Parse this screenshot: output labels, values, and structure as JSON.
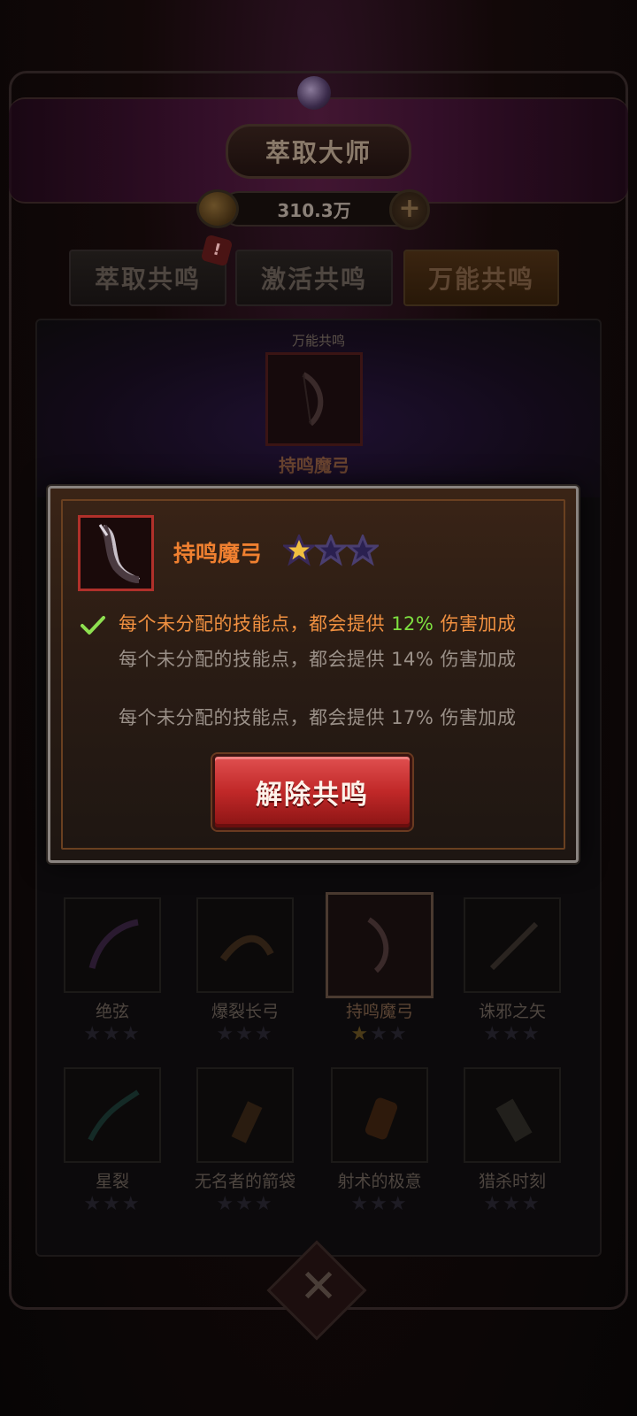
{
  "header": {
    "title": "萃取大师",
    "currency_value": "310.3万"
  },
  "tabs": [
    {
      "label": "萃取共鸣"
    },
    {
      "label": "激活共鸣"
    },
    {
      "label": "万能共鸣"
    }
  ],
  "badge": "!",
  "top_slot": {
    "label": "万能共鸣",
    "name": "持鸣魔弓"
  },
  "modal": {
    "item_name": "持鸣魔弓",
    "stars_filled": 1,
    "stars_total": 3,
    "effects": [
      {
        "text_before": "每个未分配的技能点，都会提供 ",
        "pct": "12%",
        "text_after": " 伤害加成",
        "active": true
      },
      {
        "text": "每个未分配的技能点，都会提供 14% 伤害加成",
        "active": false
      },
      {
        "text": "每个未分配的技能点，都会提供 17% 伤害加成",
        "active": false
      }
    ],
    "button_label": "解除共鸣"
  },
  "items": [
    {
      "name": "绝弦",
      "stars_filled": 0
    },
    {
      "name": "爆裂长弓",
      "stars_filled": 0
    },
    {
      "name": "持鸣魔弓",
      "stars_filled": 1,
      "selected": true
    },
    {
      "name": "诛邪之矢",
      "stars_filled": 0
    },
    {
      "name": "星裂",
      "stars_filled": 0
    },
    {
      "name": "无名者的箭袋",
      "stars_filled": 0
    },
    {
      "name": "射术的极意",
      "stars_filled": 0
    },
    {
      "name": "猎杀时刻",
      "stars_filled": 0
    }
  ],
  "colors": {
    "modal_title": "#f08030",
    "active_effect": "#f09040",
    "active_pct": "#7ee040",
    "button_red": "#c02828"
  }
}
